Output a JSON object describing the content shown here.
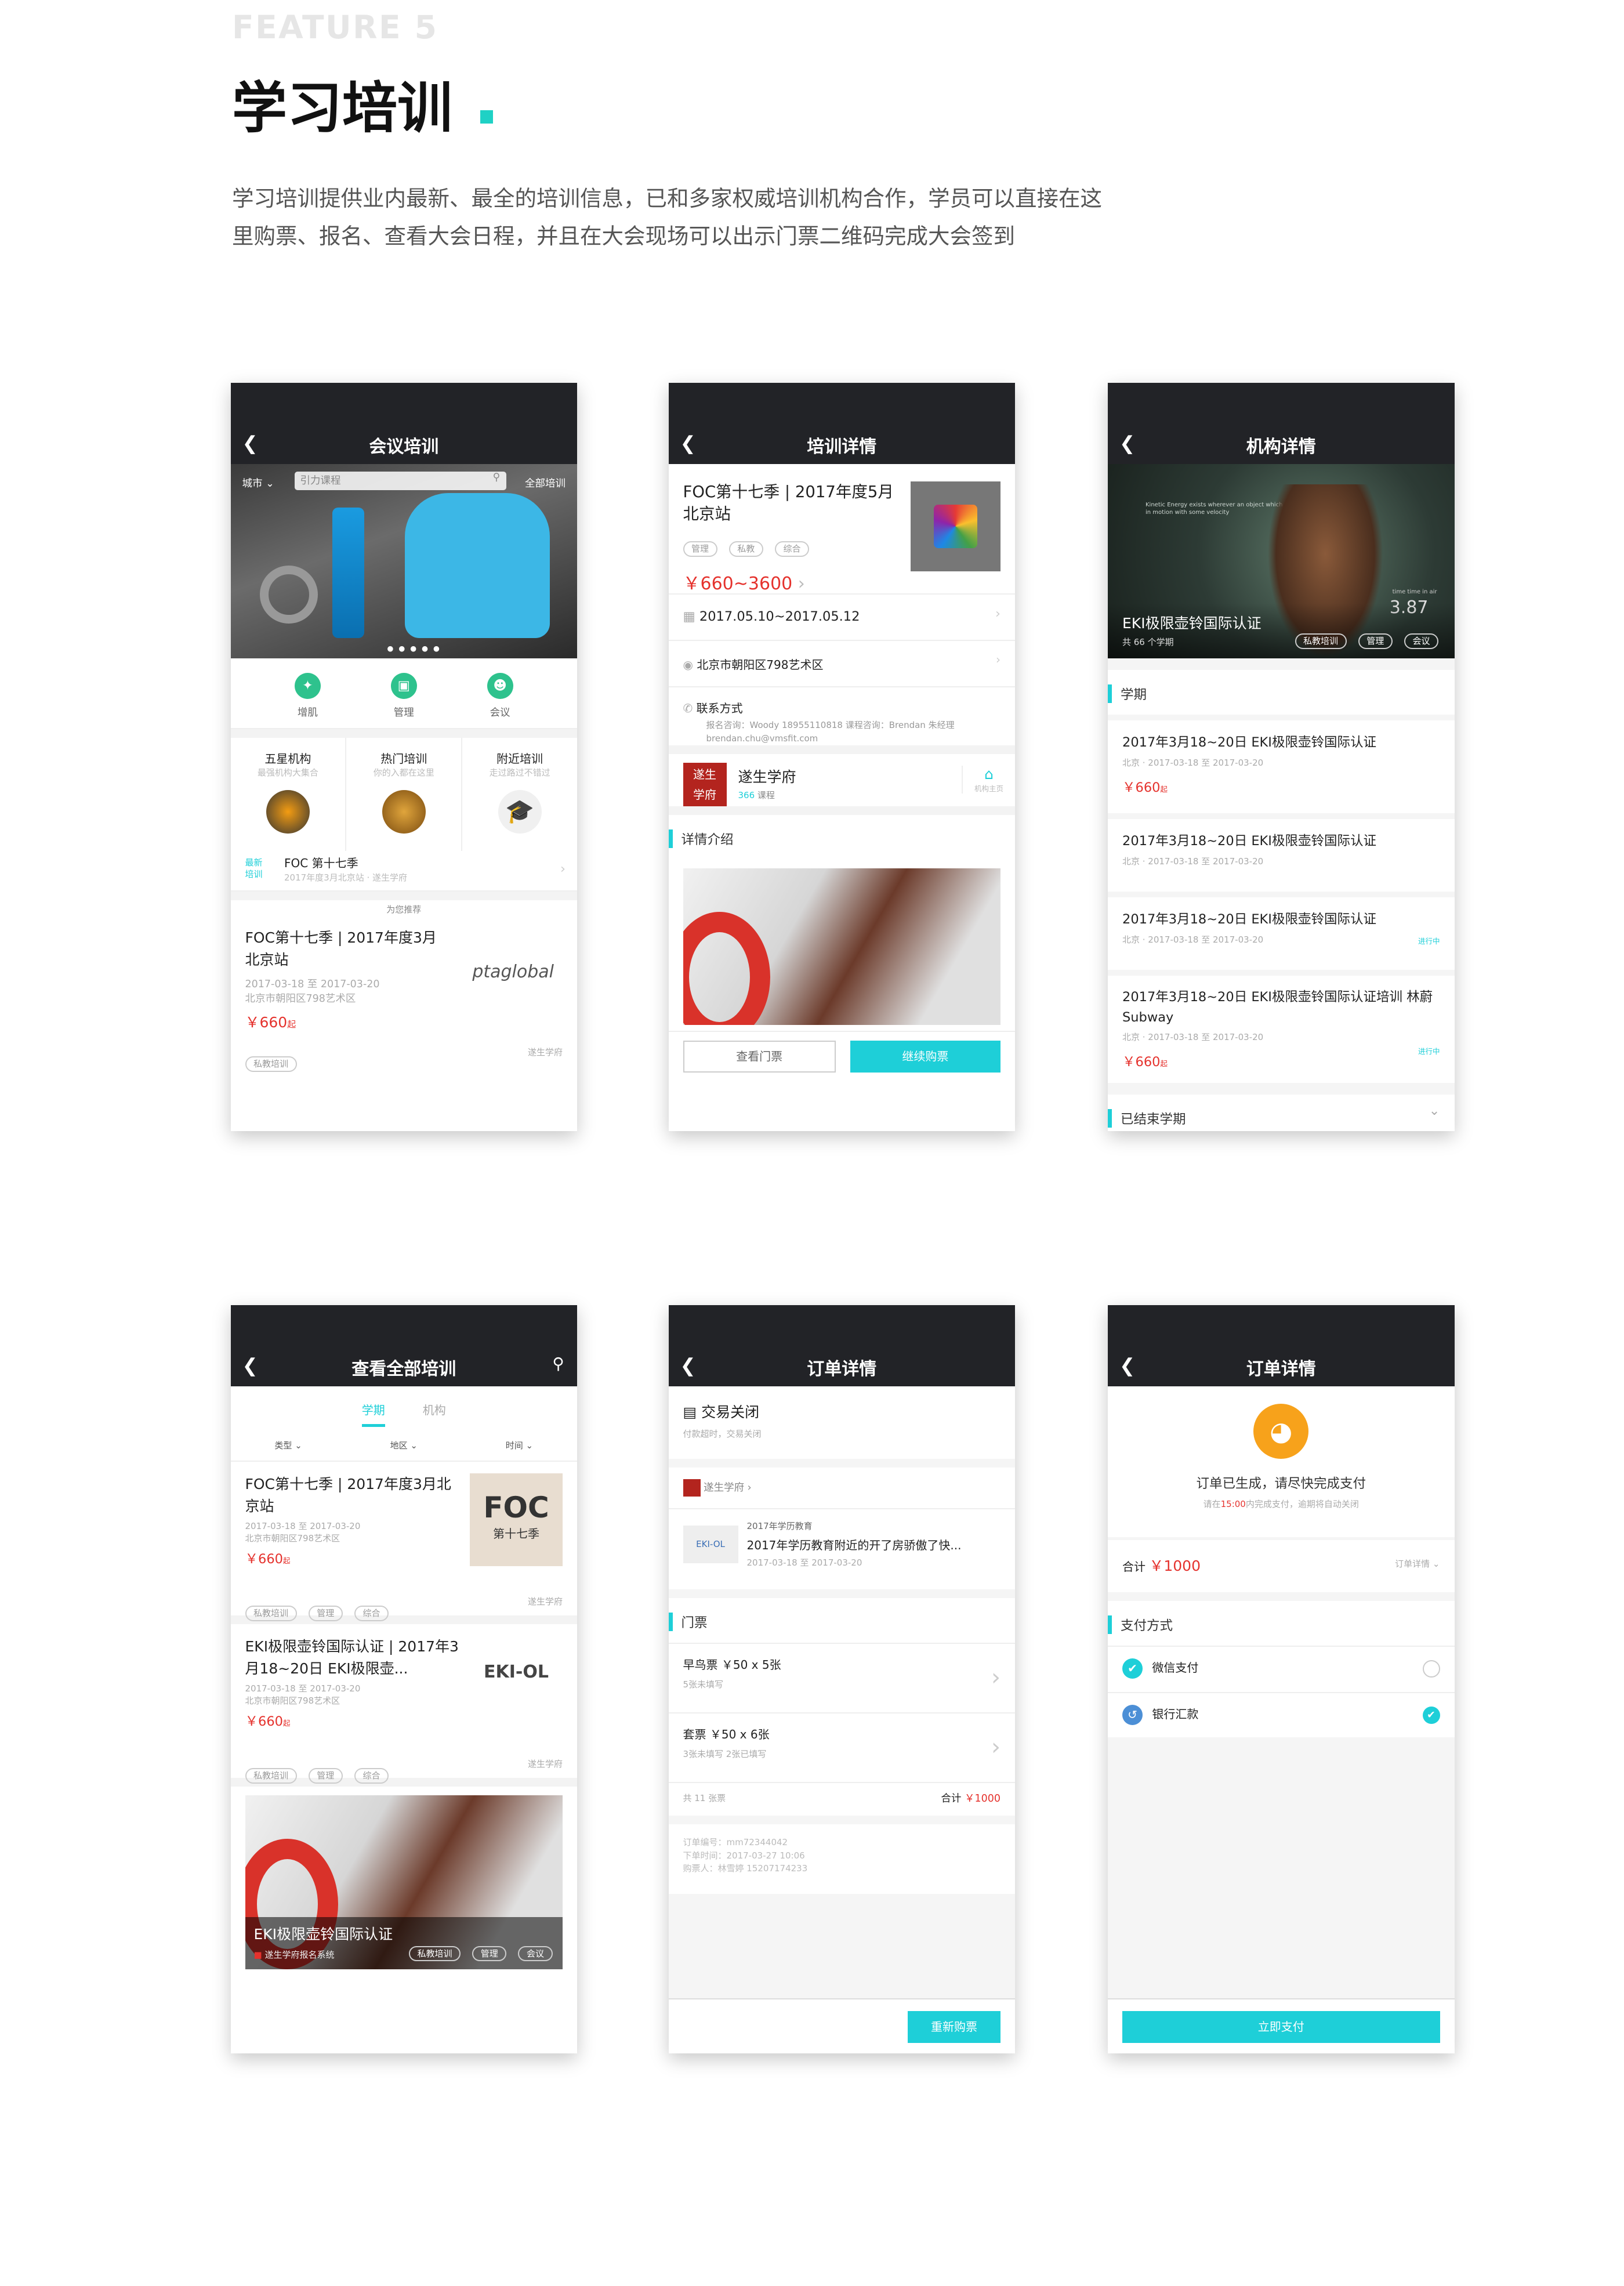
{
  "header": {
    "feature": "FEATURE 5",
    "title": "学习培训",
    "desc_line1": "学习培训提供业内最新、最全的培训信息，已和多家权威培训机构合作，学员可以直接在这",
    "desc_line2": "里购票、报名、查看大会日程，并且在大会现场可以出示门票二维码完成大会签到"
  },
  "colors": {
    "accent": "#1ecfd8",
    "price": "#e5322d",
    "topbar": "#222327",
    "title_dot": "#1fd1c5"
  },
  "p1": {
    "title": "会议培训",
    "city": "城市",
    "search_placeholder": "引力课程",
    "all": "全部培训",
    "icons": [
      {
        "label": "增肌",
        "icon": "muscle-icon"
      },
      {
        "label": "管理",
        "icon": "management-icon"
      },
      {
        "label": "会议",
        "icon": "meeting-icon"
      }
    ],
    "cats": [
      {
        "title": "五星机构",
        "sub": "最强机构大集合"
      },
      {
        "title": "热门培训",
        "sub": "你的入都在这里"
      },
      {
        "title": "附近培训",
        "sub": "走过路过不错过"
      }
    ],
    "new_badge_1": "最新",
    "new_badge_2": "培训",
    "new_title": "FOC 第十七季",
    "new_sub": "2017年度3月北京站 · 遂生学府",
    "rec": "为您推荐",
    "card_title": "FOC第十七季 | 2017年度3月北京站",
    "card_date": "2017-03-18 至 2017-03-20",
    "card_addr": "北京市朝阳区798艺术区",
    "card_price": "￥660",
    "card_price_suffix": "起",
    "card_tag": "私教培训",
    "card_org": "遂生学府",
    "logo": "ptaglobal"
  },
  "p2": {
    "title": "培训详情",
    "name": "FOC第十七季 | 2017年度5月北京站",
    "tags": [
      "管理",
      "私教",
      "综合"
    ],
    "price": "￥660~3600",
    "date": "2017.05.10~2017.05.12",
    "addr": "北京市朝阳区798艺术区",
    "contact": "联系方式",
    "contact_detail": "报名咨询：Woody 18955110818 课程咨询：Brendan 朱经理  brendan.chu@vmsfit.com",
    "org_logo_1": "遂生",
    "org_logo_2": "学府",
    "org": "遂生学府",
    "courses_num": "366",
    "courses_label": "课程",
    "home": "机构主页",
    "intro": "详情介绍",
    "btn_view": "查看门票",
    "btn_buy": "继续购票"
  },
  "p3": {
    "title": "机构详情",
    "name": "EKI极限壶铃国际认证",
    "count": "共 66 个学期",
    "tags": [
      "私教培训",
      "管理",
      "会议"
    ],
    "hero_caption": "Kinetic Energy exists wherever an object which has mass is in motion with some velocity",
    "hero_speed": "3.87",
    "hero_speed_label": "time time in air",
    "section": "学期",
    "terms": [
      {
        "title": "2017年3月18~20日 EKI极限壶铃国际认证",
        "meta": "北京 · 2017-03-18 至 2017-03-20",
        "price": "￥660",
        "status": ""
      },
      {
        "title": "2017年3月18~20日 EKI极限壶铃国际认证",
        "meta": "北京 · 2017-03-18 至 2017-03-20",
        "price": "",
        "status": ""
      },
      {
        "title": "2017年3月18~20日 EKI极限壶铃国际认证",
        "meta": "北京 · 2017-03-18 至 2017-03-20",
        "price": "",
        "status": "进行中"
      },
      {
        "title": "2017年3月18~20日 EKI极限壶铃国际认证培训 林蔚 Subway",
        "meta": "北京 · 2017-03-18 至 2017-03-20",
        "price": "￥660",
        "status": "进行中"
      }
    ],
    "price_suffix": "起",
    "ended": "已结束学期"
  },
  "p4": {
    "title": "查看全部培训",
    "tab1": "学期",
    "tab2": "机构",
    "filter": [
      "类型",
      "地区",
      "时间"
    ],
    "items": [
      {
        "title": "FOC第十七季 | 2017年度3月北京站",
        "date": "2017-03-18 至 2017-03-20",
        "addr": "北京市朝阳区798艺术区",
        "price": "￥660",
        "tags": [
          "私教培训",
          "管理",
          "综合"
        ],
        "org": "遂生学府",
        "thumb1": "FOC",
        "thumb2": "第十七季"
      },
      {
        "title": "EKI极限壶铃国际认证 | 2017年3月18~20日 EKI极限壶...",
        "date": "2017-03-18 至 2017-03-20",
        "addr": "北京市朝阳区798艺术区",
        "price": "￥660",
        "tags": [
          "私教培训",
          "管理",
          "综合"
        ],
        "org": "遂生学府",
        "thumb1": "EKI-OL",
        "thumb2": ""
      }
    ],
    "price_suffix": "起",
    "banner_title": "EKI极限壶铃国际认证",
    "banner_org": "遂生学府报名系统",
    "banner_tags": [
      "私教培训",
      "管理",
      "会议"
    ]
  },
  "p5": {
    "title": "订单详情",
    "status": "交易关闭",
    "status_sub": "付款超时，交易关闭",
    "org": "遂生学府",
    "org_logo": "遂生学府",
    "course_cat": "2017年学历教育",
    "course_title": "2017年学历教育附近的开了房骄傲了快...",
    "course_date": "2017-03-18 至 2017-03-20",
    "tickets_label": "门票",
    "tickets": [
      {
        "name": "早鸟票  ￥50 x 5张",
        "sub": "5张未填写"
      },
      {
        "name": "套票  ￥50 x 6张",
        "sub": "3张未填写  2张已填写"
      }
    ],
    "count": "共 11 张票",
    "total_label": "合计",
    "total": "￥1000",
    "order_no": "订单编号：mm72344042",
    "order_time": "下单时间：2017-03-27 10:06",
    "buyer": "购票人：林雪婷 15207174233",
    "btn": "重新购票"
  },
  "p6": {
    "title": "订单详情",
    "msg": "订单已生成，请尽快完成支付",
    "sub_pre": "请在",
    "sub_time": "15:00",
    "sub_post": "内完成支付，逾期将自动关闭",
    "total_label": "合计",
    "total": "￥1000",
    "detail": "订单详情",
    "pay_label": "支付方式",
    "methods": [
      {
        "name": "微信支付",
        "icon": "wechat-icon",
        "checked": false
      },
      {
        "name": "银行汇款",
        "icon": "bank-icon",
        "checked": true
      }
    ],
    "btn": "立即支付"
  }
}
